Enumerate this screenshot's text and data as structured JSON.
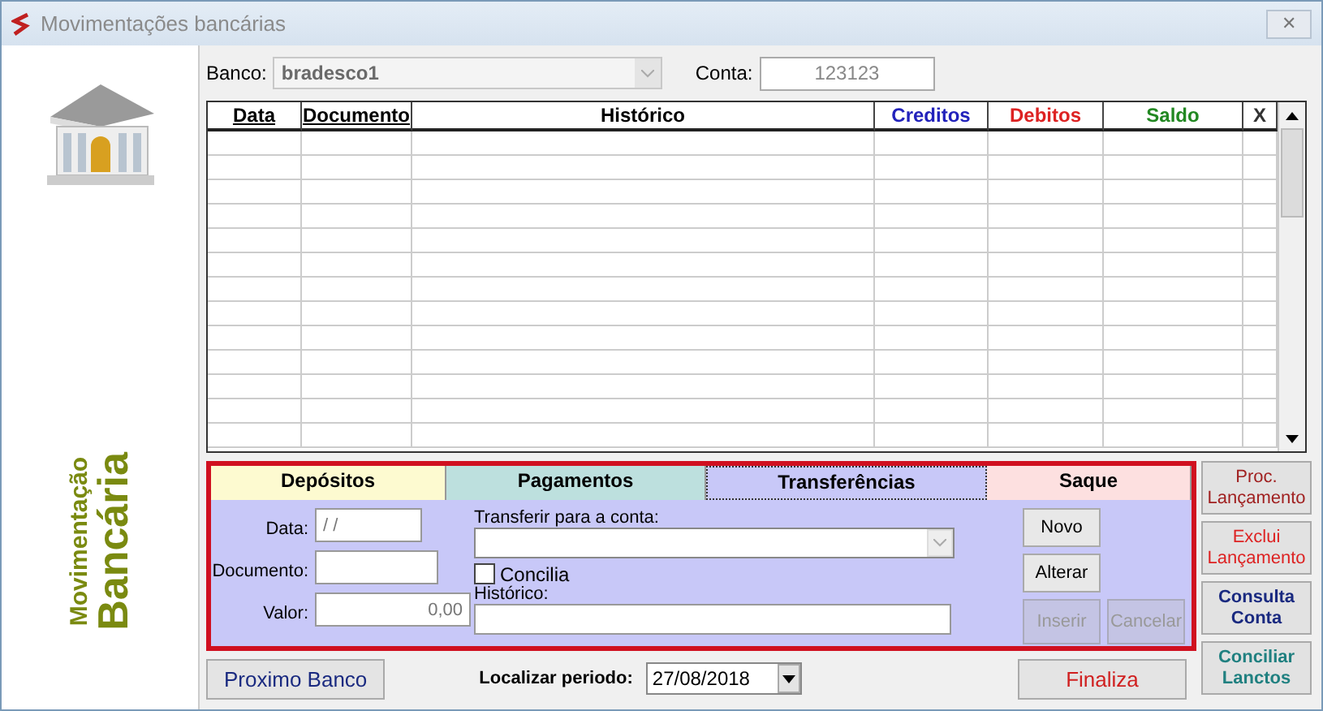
{
  "window": {
    "title": "Movimentações bancárias",
    "close_label": "✕"
  },
  "sidebar": {
    "title_small": "Movimentação",
    "title_large": "Bancária"
  },
  "account": {
    "bank_label": "Banco:",
    "bank_value": "bradesco1",
    "account_label": "Conta:",
    "account_value": "123123"
  },
  "table": {
    "columns": [
      {
        "label": "Data",
        "color": "#000000"
      },
      {
        "label": "Documento",
        "color": "#000000"
      },
      {
        "label": "Histórico",
        "color": "#000000"
      },
      {
        "label": "Creditos",
        "color": "#2222bb"
      },
      {
        "label": "Debitos",
        "color": "#dd2222"
      },
      {
        "label": "Saldo",
        "color": "#228822"
      },
      {
        "label": "X",
        "color": "#333333"
      }
    ]
  },
  "tabs": [
    {
      "label": "Depósitos",
      "selected": false,
      "color": "#fdfad0"
    },
    {
      "label": "Pagamentos",
      "selected": false,
      "color": "#bde0de"
    },
    {
      "label": "Transferências",
      "selected": true,
      "color": "#c8c8f8"
    },
    {
      "label": "Saque",
      "selected": false,
      "color": "#fde0e0"
    }
  ],
  "form": {
    "data_label": "Data:",
    "data_value": " / /",
    "document_label": "Documento:",
    "value_label": "Valor:",
    "value_value": "0,00",
    "transfer_label": "Transferir para a conta:",
    "concilia_label": "Concilia",
    "concilia_checked": false,
    "history_label": "Histórico:",
    "buttons": [
      {
        "label": "Novo",
        "disabled": false
      },
      {
        "label": "Alterar",
        "disabled": false
      },
      {
        "label": "Inserir",
        "disabled": true
      },
      {
        "label": "Cancelar",
        "disabled": true
      }
    ]
  },
  "side_buttons": [
    {
      "label": "Proc. Lançamento",
      "color": "#a02020"
    },
    {
      "label": "Exclui Lançamento",
      "color": "#dd2222"
    },
    {
      "label": "Consulta Conta",
      "color": "#1a2a80"
    },
    {
      "label": "Conciliar Lanctos",
      "color": "#208080"
    }
  ],
  "footer": {
    "next_bank": "Proximo Banco",
    "period_label": "Localizar periodo:",
    "period_value": "27/08/2018",
    "finish": "Finaliza"
  }
}
